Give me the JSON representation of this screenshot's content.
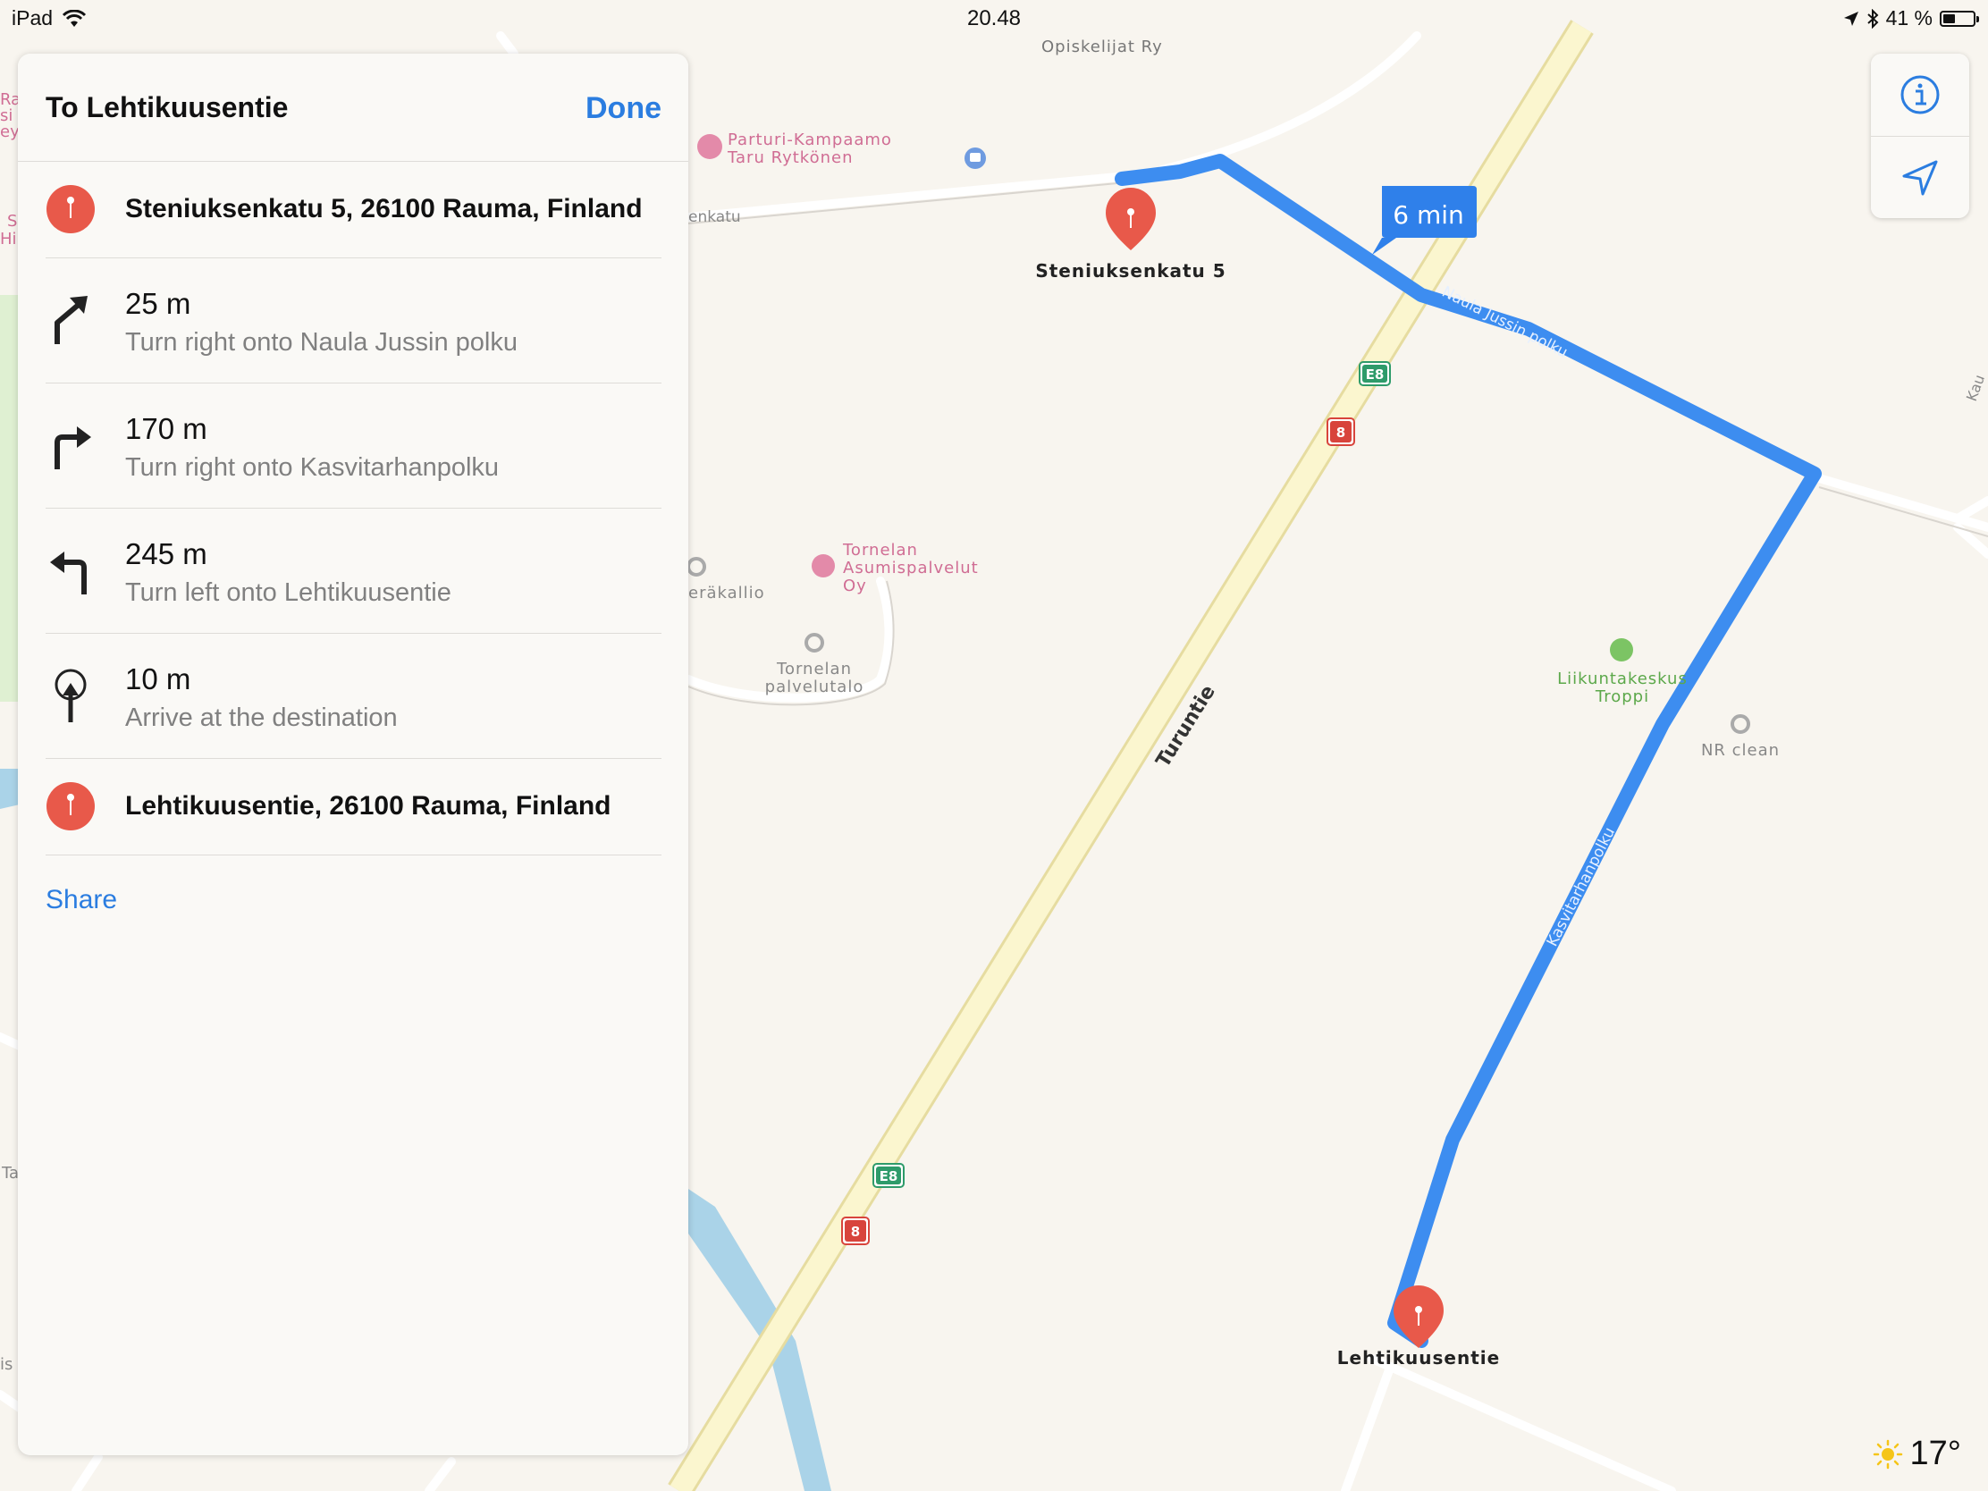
{
  "status_bar": {
    "device": "iPad",
    "time": "20.48",
    "battery": "41 %",
    "battery_level": 0.41
  },
  "panel": {
    "title": "To Lehtikuusentie",
    "done_label": "Done",
    "start": "Steniuksenkatu 5, 26100 Rauma, Finland",
    "steps": [
      {
        "distance": "25 m",
        "instruction": "Turn right onto Naula Jussin polku",
        "icon": "slight-right-arrow-icon"
      },
      {
        "distance": "170 m",
        "instruction": "Turn right onto Kasvitarhanpolku",
        "icon": "turn-right-arrow-icon"
      },
      {
        "distance": "245 m",
        "instruction": "Turn left onto Lehtikuusentie",
        "icon": "turn-left-arrow-icon"
      },
      {
        "distance": "10 m",
        "instruction": "Arrive at the destination",
        "icon": "arrive-destination-icon"
      }
    ],
    "destination": "Lehtikuusentie, 26100 Rauma, Finland",
    "share_label": "Share"
  },
  "map": {
    "route_time": "6 min",
    "start_pin_label": "Steniuksenkatu 5",
    "end_pin_label": "Lehtikuusentie",
    "poi_opiskelijat": "Opiskelijat Ry",
    "poi_parturi_1": "Parturi-Kampaamo",
    "poi_parturi_2": "Taru Rytkönen",
    "street_enkatu": "enkatu",
    "street_naula": "Naula Jussin polku",
    "street_kasvi": "Kasvitarhanpolku",
    "street_turuntie": "Turuntie",
    "shield_e8": "E8",
    "shield_8": "8",
    "poi_tornelan_as_1": "Tornelan",
    "poi_tornelan_as_2": "Asumispalvelut",
    "poi_tornelan_as_3": "Oy",
    "poi_erakallio": "eräkallio",
    "poi_tornelan_pt_1": "Tornelan",
    "poi_tornelan_pt_2": "palvelutalo",
    "poi_liikunta_1": "Liikuntakeskus",
    "poi_liikunta_2": "Troppi",
    "poi_nrclean": "NR clean",
    "edge_kau": "Kau",
    "edge_ra": "Ra",
    "edge_si": "si",
    "edge_ey": "ey",
    "edge_s": "S",
    "edge_hi": "Hi",
    "edge_ta": "Ta",
    "edge_is": "is",
    "colors": {
      "route": "#3d8df0",
      "pin": "#e8594a",
      "accent": "#2b7de0",
      "highway": "#fbf6cf",
      "water": "#aad3e8",
      "park": "#dff0d2"
    }
  },
  "weather": {
    "temperature": "17°",
    "icon": "sun-icon"
  }
}
